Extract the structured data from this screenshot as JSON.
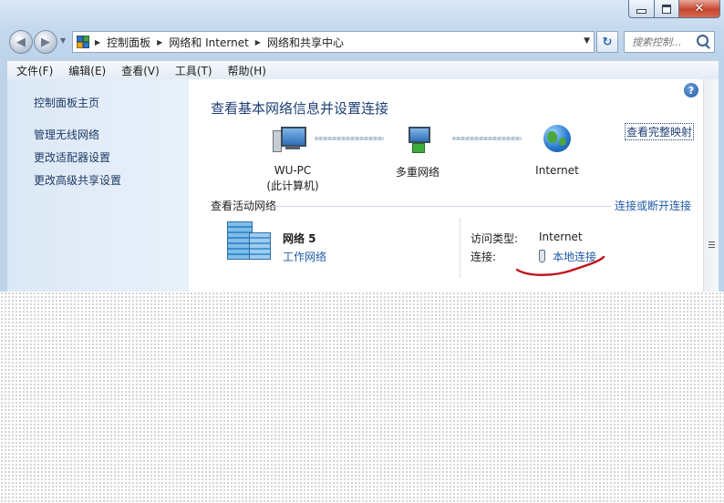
{
  "window": {
    "caption": {
      "minimize": "",
      "maximize": "",
      "close": "✕"
    }
  },
  "navigation": {
    "back_icon": "back-arrow-icon",
    "forward_icon": "forward-arrow-icon",
    "breadcrumbs": [
      "控制面板",
      "网络和 Internet",
      "网络和共享中心"
    ],
    "search_placeholder": "搜索控制...",
    "refresh_glyph": "↻"
  },
  "menubar": {
    "items": [
      "文件(F)",
      "编辑(E)",
      "查看(V)",
      "工具(T)",
      "帮助(H)"
    ]
  },
  "sidebar": {
    "items": [
      "控制面板主页",
      "管理无线网络",
      "更改适配器设置",
      "更改高级共享设置"
    ]
  },
  "content": {
    "help_glyph": "?",
    "title": "查看基本网络信息并设置连接",
    "full_map_link": "查看完整映射",
    "map_nodes": [
      {
        "label": "WU-PC",
        "sublabel": "(此计算机)",
        "icon": "computer-icon"
      },
      {
        "label": "多重网络",
        "icon": "multiple-networks-icon"
      },
      {
        "label": "Internet",
        "icon": "globe-icon"
      }
    ],
    "active_section_label": "查看活动网络",
    "connect_disconnect_link": "连接或断开连接",
    "network": {
      "name": "网络  5",
      "type_link": "工作网络",
      "access_type_label": "访问类型:",
      "access_type_value": "Internet",
      "connection_label": "连接:",
      "connection_value": "本地连接"
    }
  },
  "colors": {
    "title": "#1e3f75",
    "link": "#1e5aa8",
    "annotation": "#c0141e"
  }
}
